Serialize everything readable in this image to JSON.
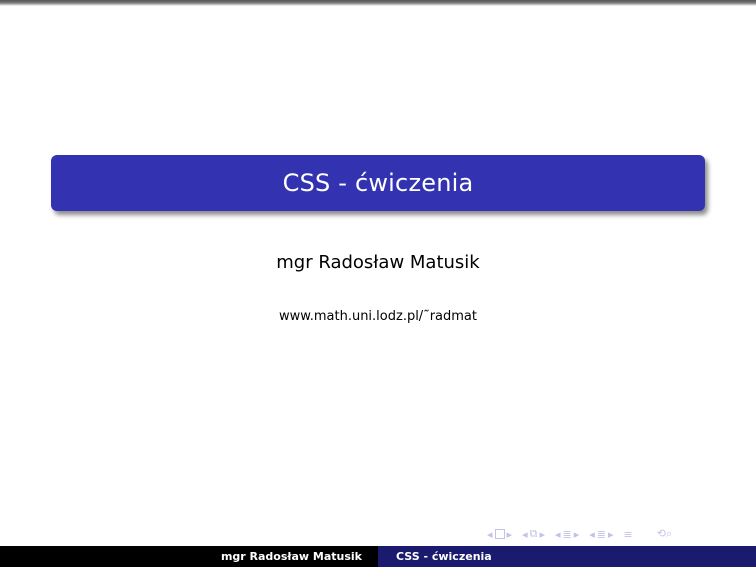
{
  "slide": {
    "title": "CSS - ćwiczenia",
    "author": "mgr Radosław Matusik",
    "url": "www.math.uni.lodz.pl/˜radmat"
  },
  "footer": {
    "author": "mgr Radosław Matusik",
    "title": "CSS - ćwiczenia"
  },
  "navigation": {
    "icons": [
      "prev-arrow-icon",
      "frame-icon",
      "next-arrow-icon",
      "prev-arrow-icon",
      "subsection-icon",
      "next-arrow-icon",
      "prev-arrow-icon",
      "section-icon",
      "next-arrow-icon",
      "prev-arrow-icon",
      "slide-icon",
      "next-arrow-icon",
      "menu-icon",
      "search-icon"
    ]
  },
  "colors": {
    "title_box": "#3333b2",
    "footer_left": "#000000",
    "footer_right": "#1a1a6e",
    "nav_icons": "#c2c2e8"
  }
}
